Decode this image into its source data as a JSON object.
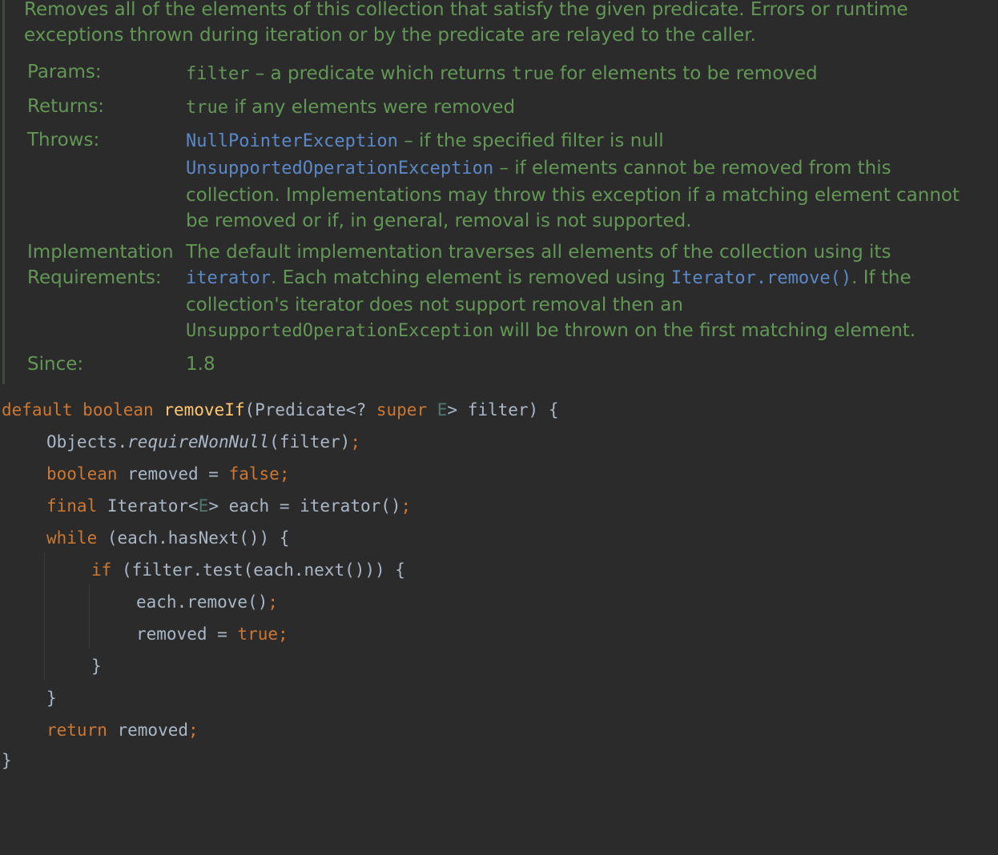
{
  "doc": {
    "description_lines": [
      "Removes all of the elements of this collection that satisfy the given predicate. Errors or runtime",
      "exceptions thrown during iteration or by the predicate are relayed to the caller."
    ],
    "params_label": "Params:",
    "params_name": "filter",
    "params_text_a": " – a predicate which returns ",
    "params_true": "true",
    "params_text_b": " for elements to be removed",
    "returns_label": "Returns:",
    "returns_true": "true",
    "returns_text": " if any elements were removed",
    "throws_label": "Throws:",
    "npe": "NullPointerException",
    "npe_text": " – if the specified filter is null",
    "uoe": "UnsupportedOperationException",
    "uoe_text_1": " – if elements cannot be removed from this",
    "uoe_text_2": "collection. Implementations may throw this exception if a matching element cannot",
    "uoe_text_3": "be removed or if, in general, removal is not supported.",
    "impl_label_1": "Implementation",
    "impl_label_2": "Requirements:",
    "impl_text_1": "The default implementation traverses all elements of the collection using its",
    "impl_iterator": "iterator",
    "impl_text_2": ". Each matching element is removed using ",
    "impl_remove": "Iterator.remove()",
    "impl_text_3": ". If the",
    "impl_text_4": "collection's iterator does not support removal then an",
    "impl_uoe": "UnsupportedOperationException",
    "impl_text_5": " will be thrown on the first matching element.",
    "since_label": "Since:",
    "since_value": "1.8"
  },
  "code": {
    "l1": {
      "kw1": "default",
      "kw2": "boolean",
      "fn": "removeIf",
      "a": "(Predicate<? ",
      "kw3": "super",
      "tp": "E",
      "b": "> filter) {"
    },
    "l2": {
      "a": "Objects.",
      "it": "requireNonNull",
      "b": "(filter)",
      "semi": ";"
    },
    "l3": {
      "kw": "boolean",
      "a": " removed = ",
      "kw2": "false",
      "semi": ";"
    },
    "l4": {
      "kw": "final",
      "a": " Iterator<",
      "tp": "E",
      "b": "> each = iterator()",
      "semi": ";"
    },
    "l5": {
      "kw": "while",
      "a": " (each.hasNext()) {"
    },
    "l6": {
      "kw": "if",
      "a": " (filter.test(each.next())) {"
    },
    "l7": {
      "a": "each.remove()",
      "semi": ";"
    },
    "l8": {
      "a": "removed = ",
      "kw": "true",
      "semi": ";"
    },
    "l9": {
      "a": "}"
    },
    "l10": {
      "a": "}"
    },
    "l11": {
      "kw": "return",
      "a": " removed",
      "semi": ";"
    },
    "l12": {
      "a": "}"
    }
  }
}
